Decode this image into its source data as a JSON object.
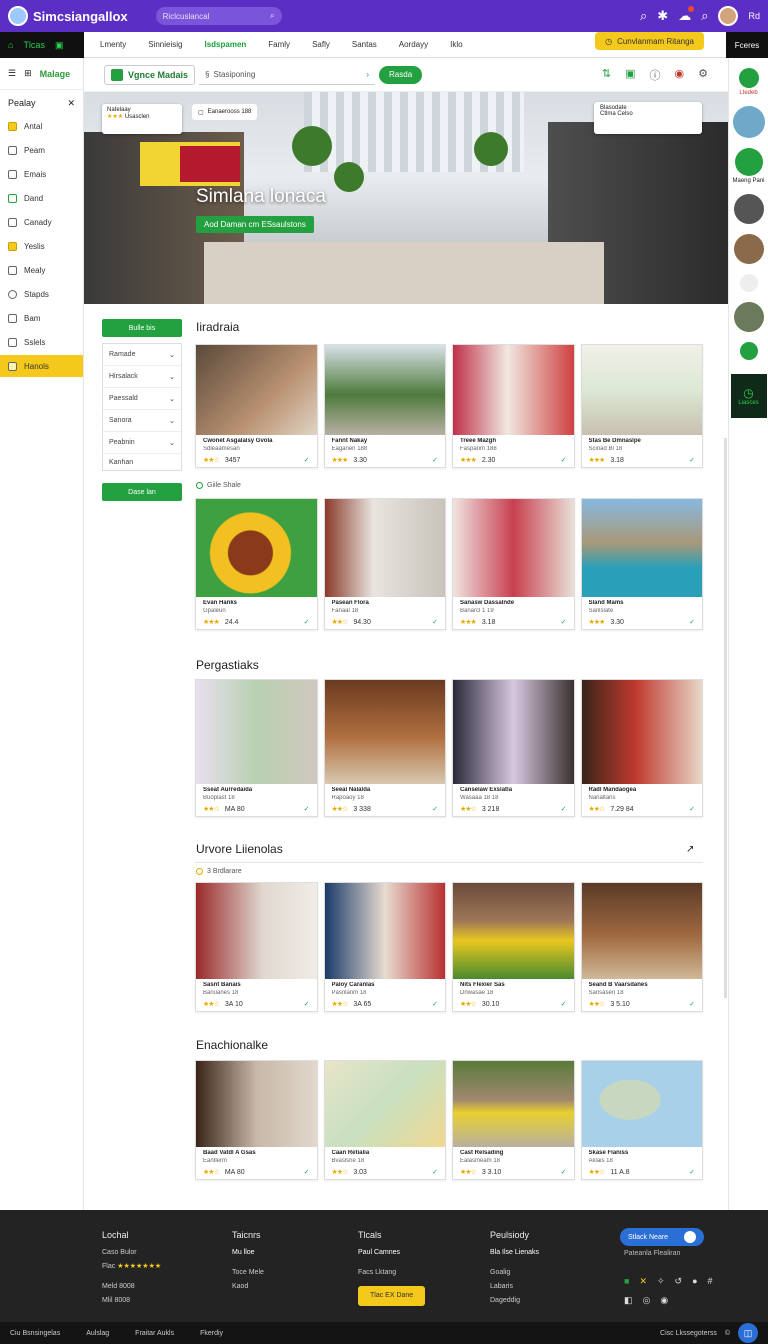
{
  "header": {
    "brand": "Simcsiangallox",
    "search_placeholder": "Riclcuslancal",
    "user_name": "Rd"
  },
  "nav": {
    "left_label": "Tlcas",
    "tabs": [
      "Lmenty",
      "Sinnieisig",
      "Isdspamen",
      "Famly",
      "Safly",
      "Santas",
      "Aordayy",
      "Iklo"
    ],
    "promo": "Cunvlanmam Ritanga",
    "right_label": "Fceres"
  },
  "sidebar": {
    "brand": "Malage",
    "title": "Pealay",
    "items": [
      {
        "label": "Antal",
        "style": "yellow"
      },
      {
        "label": "Peam",
        "style": "plain"
      },
      {
        "label": "Emais",
        "style": "plain"
      },
      {
        "label": "Dand",
        "style": "green"
      },
      {
        "label": "Canady",
        "style": "plain"
      },
      {
        "label": "Yeslis",
        "style": "yellow"
      },
      {
        "label": "Mealy",
        "style": "plain"
      },
      {
        "label": "Stapds",
        "style": "plain"
      },
      {
        "label": "Bam",
        "style": "plain"
      },
      {
        "label": "Sslels",
        "style": "plain"
      },
      {
        "label": "Hanols",
        "style": "active"
      }
    ]
  },
  "toolbar": {
    "brand": "Vgnce Madais",
    "search": "Stasiponing",
    "go": "Rasda"
  },
  "hero": {
    "title": "Simlana lonaca",
    "subtitle": "Aod Daman cm ESsaulstons",
    "card_left_title": "Natelaay",
    "card_left_stars": "★★★",
    "card_left_meta": "Usasclen",
    "chip": "Eanaerooss 188",
    "card_right_title": "Blasodate",
    "card_right_meta": "Ctlma Celso"
  },
  "filters": {
    "button": "Bulle bis",
    "rows": [
      "Ramade",
      "Hirsalack",
      "Paessald",
      "Sanora",
      "Peabnin"
    ],
    "extra": "Kanhan",
    "apply": "Dase lan"
  },
  "sections": [
    {
      "title": "Iiradraia",
      "cards": [
        {
          "t1": "Cwonet Asgalalsy Gvola",
          "t2": "Sdleaamesan",
          "stars": "★★☆",
          "price": "3457"
        },
        {
          "t1": "Fannt Nakay",
          "t2": "Eaganen 188",
          "stars": "★★★",
          "price": "3.30"
        },
        {
          "t1": "Treee Mazgh",
          "t2": "Faspanm 188",
          "stars": "★★★",
          "price": "2.30"
        },
        {
          "t1": "Stas Be Dmnaslpe",
          "t2": "Scinad Bl 18",
          "stars": "★★★",
          "price": "3.18"
        }
      ],
      "meta": "Giile Shale",
      "cards2": [
        {
          "t1": "Evan Hanks",
          "t2": "Gpaleun",
          "stars": "★★★",
          "price": "24.4"
        },
        {
          "t1": "Pasean Flora",
          "t2": "Fanaal 18",
          "stars": "★★☆",
          "price": "94.30"
        },
        {
          "t1": "Sanasw Dassalnde",
          "t2": "Banarcl 1 19",
          "stars": "★★★",
          "price": "3.18"
        },
        {
          "t1": "Sland Mams",
          "t2": "Sanlslate",
          "stars": "★★★",
          "price": "3.30"
        }
      ]
    },
    {
      "title": "Pergastiaks",
      "cards": [
        {
          "t1": "Sseat Aurredaida",
          "t2": "Buoplast 18",
          "stars": "★★☆",
          "price": "MA 80"
        },
        {
          "t1": "Seeal Nalalda",
          "t2": "Rapoaoy 18",
          "stars": "★★☆",
          "price": "3 338"
        },
        {
          "t1": "Canselaw Exslatla",
          "t2": "Wasaaa 18 18",
          "stars": "★★☆",
          "price": "3 218"
        },
        {
          "t1": "Radl Mandaogea",
          "t2": "Nanaltans",
          "stars": "★★☆",
          "price": "7.29 84"
        }
      ]
    },
    {
      "title": "Urvore Liienolas",
      "meta": "3 Brdlarare",
      "cards": [
        {
          "t1": "Sasnt Banais",
          "t2": "Banuanes 18",
          "stars": "★★☆",
          "price": "3A 10"
        },
        {
          "t1": "Paloy Caranlas",
          "t2": "Pasnlanm 18",
          "stars": "★★☆",
          "price": "3A 65"
        },
        {
          "t1": "Nits Flexier Sas",
          "t2": "Dnwasae 18",
          "stars": "★★☆",
          "price": "30.10"
        },
        {
          "t1": "Seand B Vaarsdanes",
          "t2": "Sansasen 18",
          "stars": "★★☆",
          "price": "3 5.10"
        }
      ]
    },
    {
      "title": "Enachionalke",
      "cards": [
        {
          "t1": "Baad Vatdl A Gsas",
          "t2": "Eantlerm",
          "stars": "★★☆",
          "price": "MA 80"
        },
        {
          "t1": "Caan Retialia",
          "t2": "Bvaslsne 18",
          "stars": "★★☆",
          "price": "3.03"
        },
        {
          "t1": "Cast Relsading",
          "t2": "Ealasmeam 18",
          "stars": "★★☆",
          "price": "3 3.10"
        },
        {
          "t1": "Skase Flaniss",
          "t2": "Aklais 18",
          "stars": "★★☆",
          "price": "11 A.8"
        }
      ]
    }
  ],
  "rightrail": {
    "top_label": "Ltedeb",
    "label2": "Maeng Pani",
    "dark_label": "Liasces"
  },
  "footer": {
    "col1": {
      "h": "Lochal",
      "l1": "Caso Bulor",
      "l2": "Flac",
      "stars": "★★★★★★★",
      "l3": "Meld 8008",
      "l4": "Mlil 8008"
    },
    "col2": {
      "h": "Taicnrs",
      "b": "Mu lloe",
      "l1": "Toce Mele",
      "l2": "Kaod"
    },
    "col3": {
      "h": "Tlcals",
      "b": "Paul Camnes",
      "l1": "Facs Lktang",
      "btn": "Tlac EX Dane"
    },
    "col4": {
      "h": "Peulsiody",
      "b": "Bla Ilse Lienaks",
      "l1": "Goalig",
      "l2": "Labaris",
      "l3": "Dageddig"
    },
    "toggle": "Stlack Neare",
    "toggle_sub": "Pateanla Flealiran"
  },
  "bottombar": {
    "items": [
      "Ciu Bsnsingelas",
      "Aulslag",
      "Fraitar Aukls",
      "Fkerdiy"
    ],
    "right": "Cisc Lkssegoterss"
  },
  "colors": {
    "header": "#5b2fc4",
    "green": "#23a040",
    "yellow": "#f4c91c",
    "footer": "#232323"
  }
}
